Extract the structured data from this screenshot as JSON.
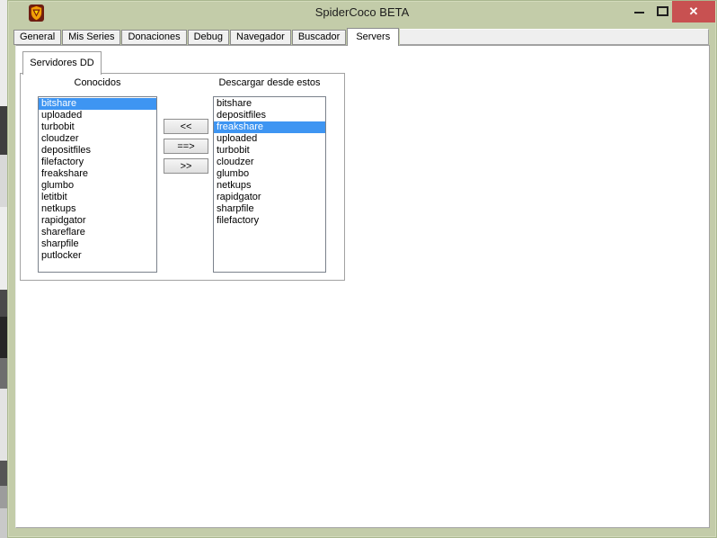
{
  "window": {
    "title": "SpiderCoco BETA",
    "close_glyph": "✕"
  },
  "tabs": {
    "items": [
      {
        "label": "General",
        "active": false
      },
      {
        "label": "Mis Series",
        "active": false
      },
      {
        "label": "Donaciones",
        "active": false
      },
      {
        "label": "Debug",
        "active": false
      },
      {
        "label": "Navegador",
        "active": false
      },
      {
        "label": "Buscador",
        "active": false
      },
      {
        "label": "Servers",
        "active": true
      }
    ]
  },
  "servers_page": {
    "subtab_label": "Servidores DD",
    "known_column_label": "Conocidos",
    "download_column_label": "Descargar desde estos",
    "known_servers": [
      "bitshare",
      "uploaded",
      "turbobit",
      "cloudzer",
      "depositfiles",
      "filefactory",
      "freakshare",
      "glumbo",
      "letitbit",
      "netkups",
      "rapidgator",
      "shareflare",
      "sharpfile",
      "putlocker"
    ],
    "known_selected": "bitshare",
    "download_servers": [
      "bitshare",
      "depositfiles",
      "freakshare",
      "uploaded",
      "turbobit",
      "cloudzer",
      "glumbo",
      "netkups",
      "rapidgator",
      "sharpfile",
      "filefactory"
    ],
    "download_selected": "freakshare",
    "transfer_buttons": [
      {
        "name": "move-to-known-button",
        "label": "<<"
      },
      {
        "name": "move-all-to-download-button",
        "label": "==>"
      },
      {
        "name": "move-to-download-button",
        "label": ">>"
      }
    ]
  },
  "colors": {
    "titlebar_green": "#c3cca9",
    "frame_green": "#a9b78f",
    "selection_blue": "#3e95f2",
    "close_button_red": "#c85151"
  }
}
